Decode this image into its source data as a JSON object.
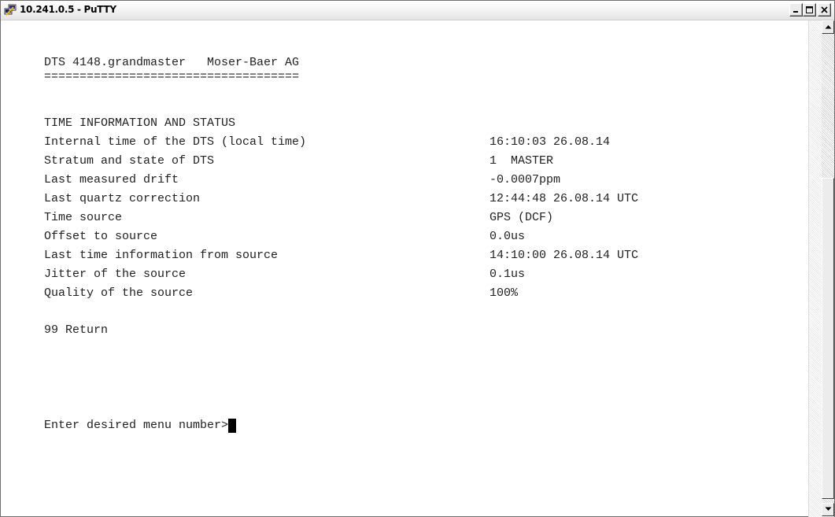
{
  "window": {
    "title": "10.241.0.5 - PuTTY"
  },
  "terminal": {
    "header": "DTS 4148.grandmaster   Moser-Baer AG",
    "separator": "====================================",
    "section_title": "TIME INFORMATION AND STATUS",
    "rows": [
      {
        "label": "Internal time of the DTS (local time)",
        "value": "16:10:03 26.08.14"
      },
      {
        "label": "Stratum and state of DTS",
        "value": "1  MASTER"
      },
      {
        "label": "Last measured drift",
        "value": "-0.0007ppm"
      },
      {
        "label": "Last quartz correction",
        "value": "12:44:48 26.08.14 UTC"
      },
      {
        "label": "Time source",
        "value": "GPS (DCF)"
      },
      {
        "label": "Offset to source",
        "value": "0.0us"
      },
      {
        "label": "Last time information from source",
        "value": "14:10:00 26.08.14 UTC"
      },
      {
        "label": "Jitter of the source",
        "value": "0.1us"
      },
      {
        "label": "Quality of the source",
        "value": "100%"
      }
    ],
    "return_option": "99 Return",
    "prompt": "Enter desired menu number>"
  },
  "icons": {
    "app": "putty-icon",
    "minimize": "minimize-icon",
    "maximize": "maximize-icon",
    "close": "close-icon",
    "scroll_up": "scroll-up-arrow-icon",
    "scroll_down": "scroll-down-arrow-icon"
  }
}
